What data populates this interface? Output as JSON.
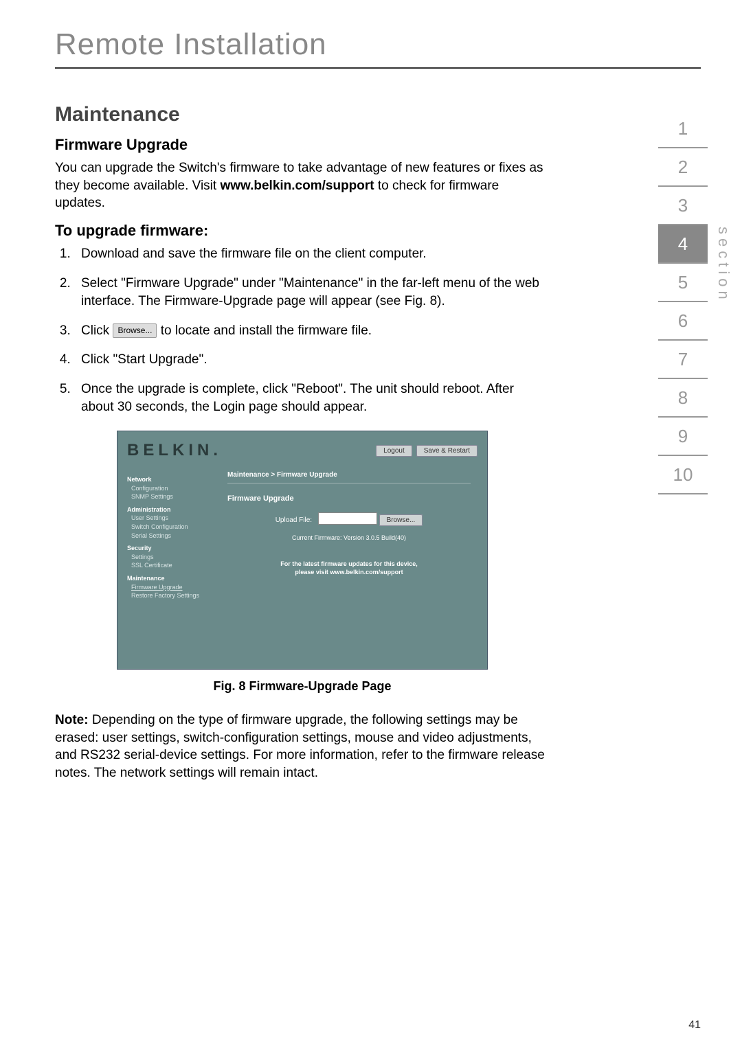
{
  "doc": {
    "title": "Remote Installation",
    "page_number": "41",
    "section_label": "section"
  },
  "section_tabs": [
    "1",
    "2",
    "3",
    "4",
    "5",
    "6",
    "7",
    "8",
    "9",
    "10"
  ],
  "active_tab_index": 3,
  "headings": {
    "maintenance": "Maintenance",
    "firmware_upgrade": "Firmware Upgrade",
    "to_upgrade": "To upgrade firmware:"
  },
  "intro": {
    "pre": "You can upgrade the Switch's firmware to take advantage of new features or fixes as they become available. Visit ",
    "bold": "www.belkin.com/support",
    "post": " to check for firmware updates."
  },
  "steps": {
    "s1": "Download and save the firmware file on the client computer.",
    "s2": "Select \"Firmware Upgrade\" under \"Maintenance\" in the far-left menu of the web interface. The Firmware-Upgrade page will appear (see Fig. 8).",
    "s3_pre": "Click ",
    "s3_btn": "Browse...",
    "s3_post": " to locate and install the firmware file.",
    "s4": "Click \"Start Upgrade\".",
    "s5": "Once the upgrade is complete, click \"Reboot\". The unit should reboot. After about 30 seconds, the Login page should appear."
  },
  "figure": {
    "caption": "Fig. 8 Firmware-Upgrade Page"
  },
  "note": {
    "label": "Note:",
    "text": " Depending on the type of firmware upgrade, the following settings may be erased: user settings, switch-configuration settings, mouse and video adjustments, and RS232 serial-device settings. For more information, refer to the firmware release notes. The network settings will remain intact."
  },
  "screenshot": {
    "logo": "BELKIN.",
    "logout": "Logout",
    "save_restart": "Save & Restart",
    "breadcrumb": "Maintenance > Firmware Upgrade",
    "panel_title": "Firmware Upgrade",
    "upload_label": "Upload File:",
    "browse_btn": "Browse...",
    "version_text": "Current Firmware: Version 3.0.5 Build(40)",
    "support_line1": "For the latest firmware updates for this device,",
    "support_line2": "please visit www.belkin.com/support",
    "sidebar": {
      "network": "Network",
      "configuration": "Configuration",
      "snmp": "SNMP Settings",
      "administration": "Administration",
      "user_settings": "User Settings",
      "switch_config": "Switch Configuration",
      "serial_settings": "Serial Settings",
      "security": "Security",
      "sec_settings": "Settings",
      "ssl": "SSL Certificate",
      "maintenance": "Maintenance",
      "firmware_upgrade": "Firmware Upgrade",
      "restore": "Restore Factory Settings"
    }
  }
}
